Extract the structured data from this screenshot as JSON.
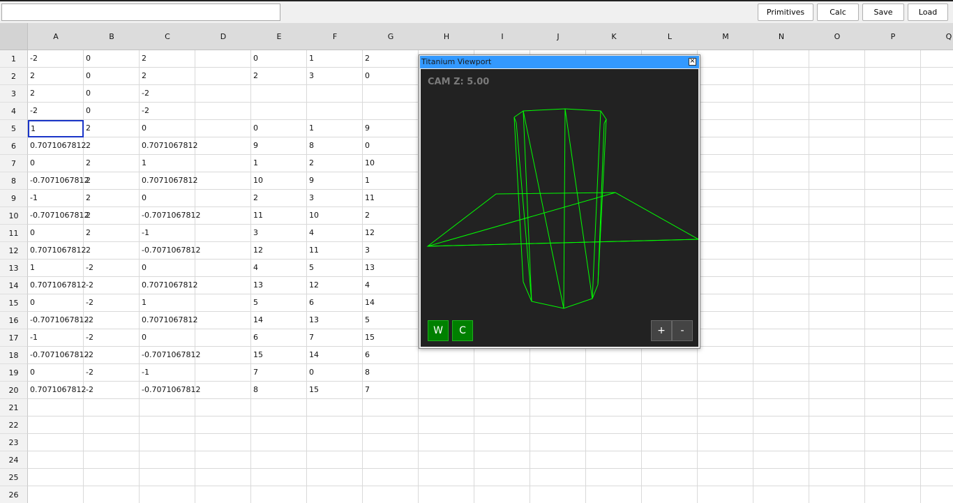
{
  "toolbar": {
    "formula_value": "",
    "primitives_label": "Primitives",
    "calc_label": "Calc",
    "save_label": "Save",
    "load_label": "Load"
  },
  "columns": [
    "A",
    "B",
    "C",
    "D",
    "E",
    "F",
    "G",
    "H",
    "I",
    "J",
    "K",
    "L",
    "M",
    "N",
    "O",
    "P",
    "Q"
  ],
  "rows": [
    [
      "-2",
      "0",
      "2",
      "",
      "0",
      "1",
      "2"
    ],
    [
      "2",
      "0",
      "2",
      "",
      "2",
      "3",
      "0"
    ],
    [
      "2",
      "0",
      "-2",
      "",
      "",
      "",
      ""
    ],
    [
      "-2",
      "0",
      "-2",
      "",
      "",
      "",
      ""
    ],
    [
      "1",
      "2",
      "0",
      "",
      "0",
      "1",
      "9"
    ],
    [
      "0.7071067812",
      "2",
      "0.7071067812",
      "",
      "9",
      "8",
      "0"
    ],
    [
      "0",
      "2",
      "1",
      "",
      "1",
      "2",
      "10"
    ],
    [
      "-0.7071067812",
      "2",
      "0.7071067812",
      "",
      "10",
      "9",
      "1"
    ],
    [
      "-1",
      "2",
      "0",
      "",
      "2",
      "3",
      "11"
    ],
    [
      "-0.7071067812",
      "2",
      "-0.7071067812",
      "",
      "11",
      "10",
      "2"
    ],
    [
      "0",
      "2",
      "-1",
      "",
      "3",
      "4",
      "12"
    ],
    [
      "0.7071067812",
      "2",
      "-0.7071067812",
      "",
      "12",
      "11",
      "3"
    ],
    [
      "1",
      "-2",
      "0",
      "",
      "4",
      "5",
      "13"
    ],
    [
      "0.7071067812",
      "-2",
      "0.7071067812",
      "",
      "13",
      "12",
      "4"
    ],
    [
      "0",
      "-2",
      "1",
      "",
      "5",
      "6",
      "14"
    ],
    [
      "-0.7071067812",
      "-2",
      "0.7071067812",
      "",
      "14",
      "13",
      "5"
    ],
    [
      "-1",
      "-2",
      "0",
      "",
      "6",
      "7",
      "15"
    ],
    [
      "-0.7071067812",
      "-2",
      "-0.7071067812",
      "",
      "15",
      "14",
      "6"
    ],
    [
      "0",
      "-2",
      "-1",
      "",
      "7",
      "0",
      "8"
    ],
    [
      "0.7071067812",
      "-2",
      "-0.7071067812",
      "",
      "8",
      "15",
      "7"
    ],
    [],
    [],
    [],
    [],
    [],
    []
  ],
  "selected_cell": "A5",
  "viewport": {
    "title": "Titanium Viewport",
    "close_glyph": "×",
    "cam_label": "CAM Z: 5.00",
    "wireframe_color": "#00ff00",
    "btn_w": "W",
    "btn_c": "C",
    "btn_zoom_in": "+",
    "btn_zoom_out": "-"
  }
}
